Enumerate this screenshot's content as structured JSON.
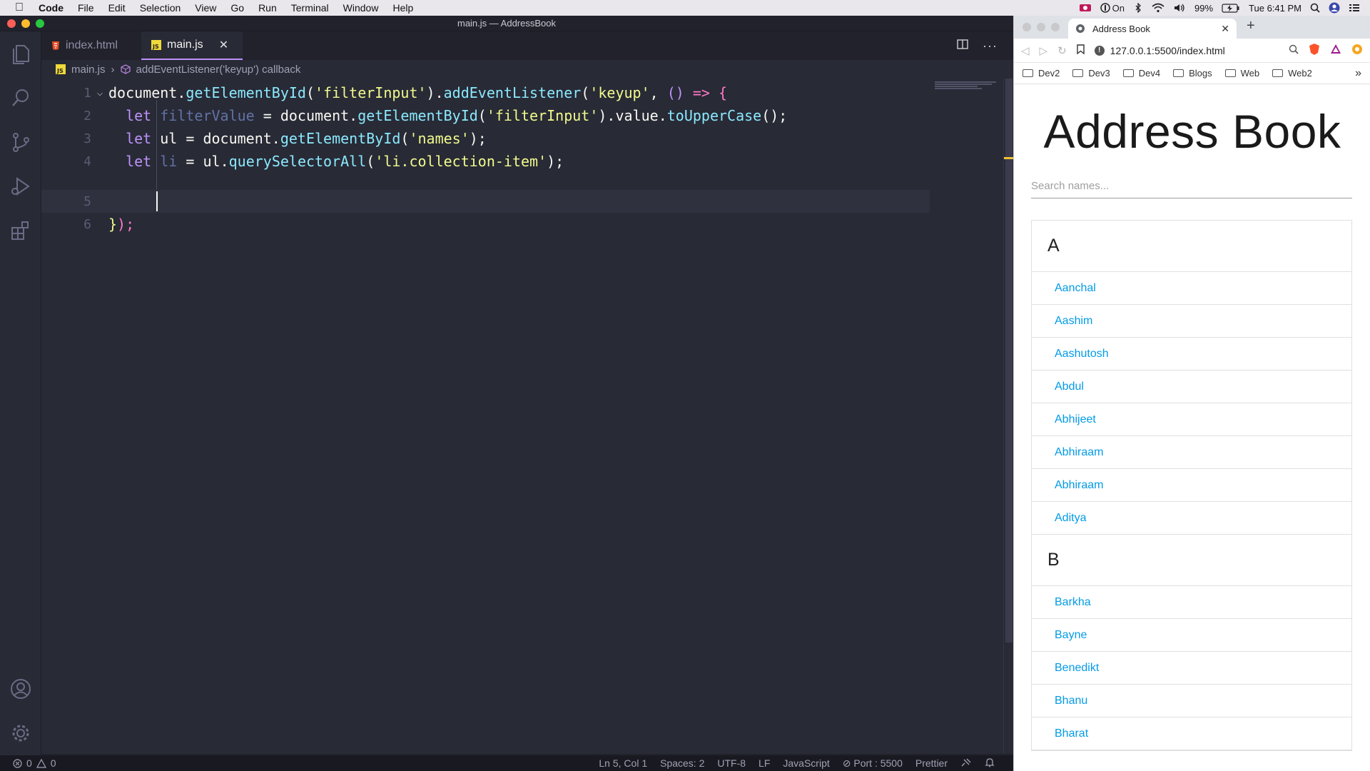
{
  "menubar": {
    "app": "Code",
    "items": [
      "File",
      "Edit",
      "Selection",
      "View",
      "Go",
      "Run",
      "Terminal",
      "Window",
      "Help"
    ],
    "status_on": "On",
    "battery": "99%",
    "clock": "Tue 6:41 PM"
  },
  "vscode": {
    "window_title": "main.js — AddressBook",
    "tabs": [
      {
        "label": "index.html",
        "icon": "html5-icon"
      },
      {
        "label": "main.js",
        "icon": "js-icon",
        "active": true
      }
    ],
    "breadcrumb": {
      "file": "main.js",
      "symbol": "addEventListener('keyup') callback"
    },
    "line_numbers": [
      "1",
      "2",
      "3",
      "4",
      "5",
      "6"
    ],
    "code": {
      "l1": [
        {
          "t": "document",
          "c": "k-plain"
        },
        {
          "t": ".",
          "c": "k-plain"
        },
        {
          "t": "getElementById",
          "c": "k-fn"
        },
        {
          "t": "(",
          "c": "k-plain"
        },
        {
          "t": "'filterInput'",
          "c": "k-str"
        },
        {
          "t": ").",
          "c": "k-plain"
        },
        {
          "t": "addEventListener",
          "c": "k-fn"
        },
        {
          "t": "(",
          "c": "k-plain"
        },
        {
          "t": "'keyup'",
          "c": "k-str"
        },
        {
          "t": ", ",
          "c": "k-plain"
        },
        {
          "t": "()",
          "c": "k-let"
        },
        {
          "t": " ",
          "c": "k-plain"
        },
        {
          "t": "=>",
          "c": "k-arrow"
        },
        {
          "t": " ",
          "c": "k-plain"
        },
        {
          "t": "{",
          "c": "k-arrow"
        }
      ],
      "l2": [
        {
          "t": "  ",
          "c": "k-plain"
        },
        {
          "t": "let",
          "c": "k-let"
        },
        {
          "t": " ",
          "c": "k-plain"
        },
        {
          "t": "filterValue",
          "c": "k-var"
        },
        {
          "t": " = ",
          "c": "k-plain"
        },
        {
          "t": "document",
          "c": "k-plain"
        },
        {
          "t": ".",
          "c": "k-plain"
        },
        {
          "t": "getElementById",
          "c": "k-fn"
        },
        {
          "t": "(",
          "c": "k-plain"
        },
        {
          "t": "'filterInput'",
          "c": "k-str"
        },
        {
          "t": ").",
          "c": "k-plain"
        },
        {
          "t": "value",
          "c": "k-plain"
        },
        {
          "t": ".",
          "c": "k-plain"
        },
        {
          "t": "toUpperCase",
          "c": "k-fn"
        },
        {
          "t": "();",
          "c": "k-plain"
        }
      ],
      "l3": [
        {
          "t": "  ",
          "c": "k-plain"
        },
        {
          "t": "let",
          "c": "k-let"
        },
        {
          "t": " ul = ",
          "c": "k-plain"
        },
        {
          "t": "document",
          "c": "k-plain"
        },
        {
          "t": ".",
          "c": "k-plain"
        },
        {
          "t": "getElementById",
          "c": "k-fn"
        },
        {
          "t": "(",
          "c": "k-plain"
        },
        {
          "t": "'names'",
          "c": "k-str"
        },
        {
          "t": ");",
          "c": "k-plain"
        }
      ],
      "l4": [
        {
          "t": "  ",
          "c": "k-plain"
        },
        {
          "t": "let",
          "c": "k-let"
        },
        {
          "t": " ",
          "c": "k-plain"
        },
        {
          "t": "li",
          "c": "k-var"
        },
        {
          "t": " = ul.",
          "c": "k-plain"
        },
        {
          "t": "querySelectorAll",
          "c": "k-fn"
        },
        {
          "t": "(",
          "c": "k-plain"
        },
        {
          "t": "'li.collection-item'",
          "c": "k-str"
        },
        {
          "t": ");",
          "c": "k-plain"
        }
      ],
      "l5": [],
      "l6": [
        {
          "t": "}",
          "c": "k-brace"
        },
        {
          "t": ");",
          "c": "k-arrow"
        }
      ]
    },
    "status": {
      "errors": "0",
      "warnings": "0",
      "position": "Ln 5, Col 1",
      "spaces": "Spaces: 2",
      "encoding": "UTF-8",
      "eol": "LF",
      "language": "JavaScript",
      "port": "Port : 5500",
      "formatter": "Prettier"
    }
  },
  "browser": {
    "tab_title": "Address Book",
    "url": "127.0.0.1:5500/index.html",
    "bookmarks": [
      "Dev2",
      "Dev3",
      "Dev4",
      "Blogs",
      "Web",
      "Web2"
    ],
    "page": {
      "heading": "Address Book",
      "search_placeholder": "Search names...",
      "groups": [
        {
          "letter": "A",
          "names": [
            "Aanchal",
            "Aashim",
            "Aashutosh",
            "Abdul",
            "Abhijeet",
            "Abhiraam",
            "Abhiraam",
            "Aditya"
          ]
        },
        {
          "letter": "B",
          "names": [
            "Barkha",
            "Bayne",
            "Benedikt",
            "Bhanu",
            "Bharat"
          ]
        }
      ]
    }
  },
  "colors": {
    "editor_bg": "#282a36",
    "activity_bg": "#282a36",
    "accent": "#bd93f9",
    "link": "#039be5"
  }
}
